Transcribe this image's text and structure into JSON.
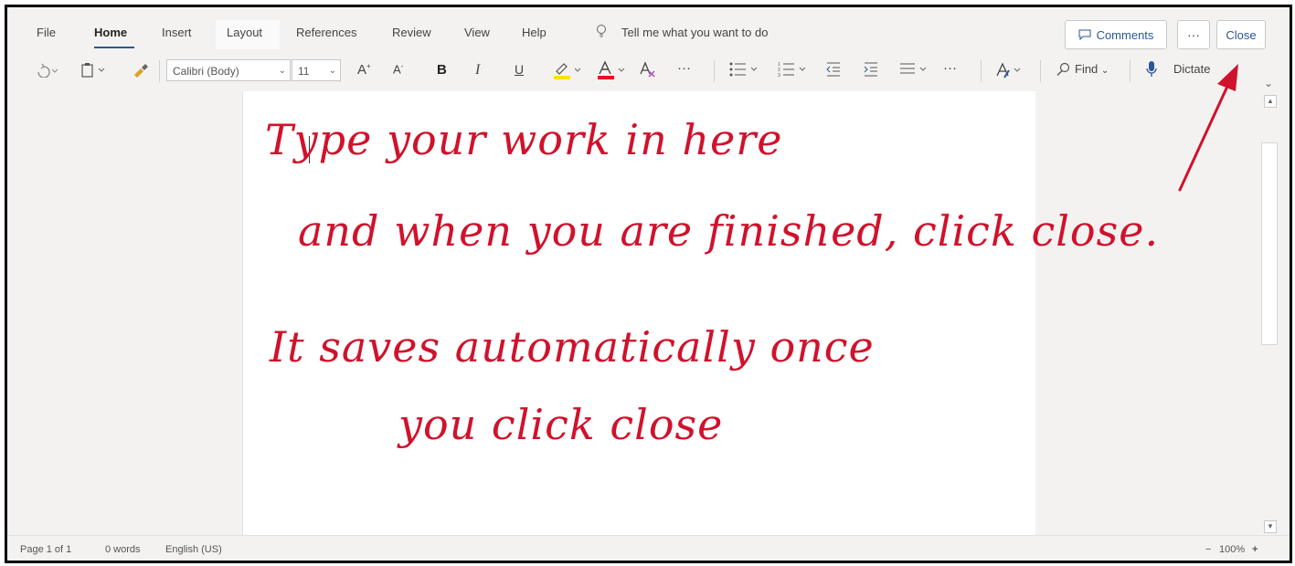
{
  "tabs": [
    "File",
    "Home",
    "Insert",
    "Layout",
    "References",
    "Review",
    "View",
    "Help"
  ],
  "tell_me": "Tell me what you want to do",
  "buttons": {
    "comments": "Comments",
    "more": "···",
    "close": "Close"
  },
  "toolbar": {
    "font_name": "Calibri (Body)",
    "font_size": "11",
    "grow_font": "A",
    "shrink_font": "A",
    "bold": "B",
    "italic": "I",
    "underline": "U",
    "more1": "···",
    "more2": "···",
    "find": "Find",
    "dictate": "Dictate"
  },
  "status": {
    "page": "Page 1 of 1",
    "words": "0 words",
    "language": "English (US)",
    "zoom": "100%"
  },
  "annotation": {
    "lines": [
      "Type your work in here",
      "and when you are finished, click close.",
      "It saves automatically once",
      "you click close"
    ],
    "color": "#d0122c"
  },
  "colors": {
    "accent": "#2b579a",
    "highlight": "#ffe000",
    "font_color": "#e81123"
  }
}
